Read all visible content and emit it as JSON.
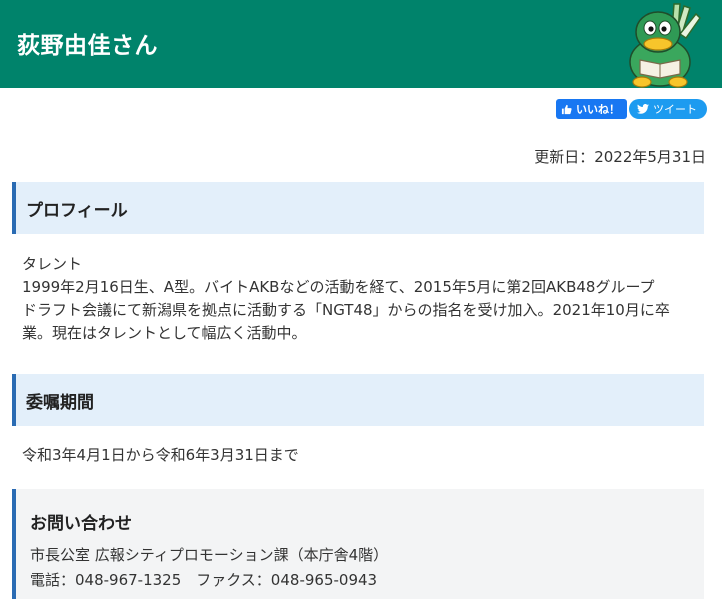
{
  "header": {
    "title": "荻野由佳さん",
    "bg_color": "#00836b",
    "mascot_icon": "mascot-character-icon"
  },
  "social": {
    "like_label": "いいね！",
    "tweet_label": "ツイート"
  },
  "updated": "更新日：2022年5月31日",
  "sections": {
    "profile": {
      "heading": "プロフィール",
      "lines": [
        "タレント",
        "1999年2月16日生、A型。バイトAKBなどの活動を経て、2015年5月に第2回AKB48グループ",
        "ドラフト会議にて新潟県を拠点に活動する「NGT48」からの指名を受け加入。2021年10月に卒",
        "業。現在はタレントとして幅広く活動中。"
      ]
    },
    "period": {
      "heading": "委嘱期間",
      "text": "令和3年4月1日から令和6年3月31日まで"
    }
  },
  "contact": {
    "title": "お問い合わせ",
    "department": "市長公室 広報シティプロモーション課（本庁舎4階）",
    "phone": "電話：048-967-1325　ファクス：048-965-0943"
  },
  "colors": {
    "accent": "#2a6bb3",
    "heading_bg": "#e3effa",
    "contact_bg": "#f3f4f5"
  }
}
